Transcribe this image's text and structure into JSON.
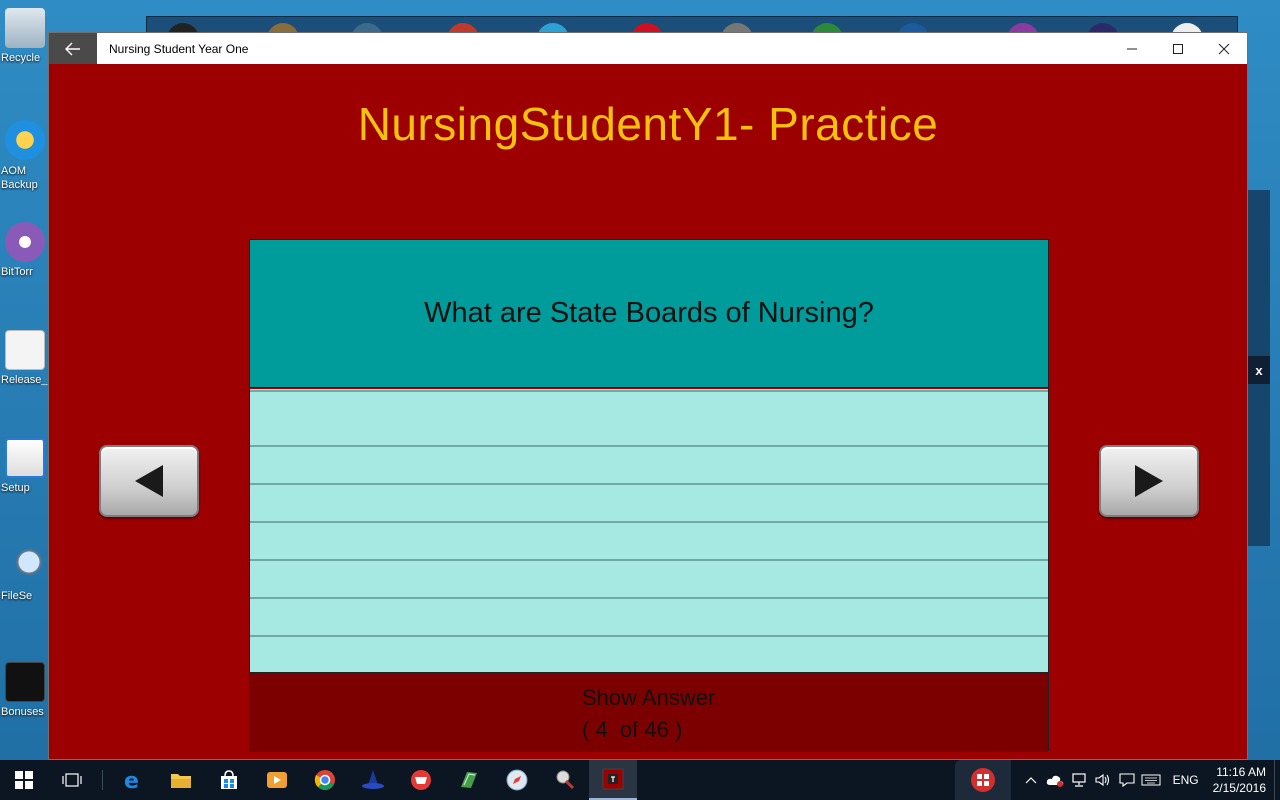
{
  "desktop": {
    "icons": [
      {
        "label": "Recycle",
        "icon": "recycle-bin-icon"
      },
      {
        "label": "AOM Backup",
        "icon": "backup-icon"
      },
      {
        "label": "BitTorr",
        "icon": "bittorrent-icon"
      },
      {
        "label": "Release_",
        "icon": "document-icon"
      },
      {
        "label": "Setup",
        "icon": "setup-icon"
      },
      {
        "label": "FileSe",
        "icon": "file-search-icon"
      },
      {
        "label": "Bonuses",
        "icon": "terminal-icon"
      }
    ]
  },
  "window": {
    "title": "Nursing Student Year One",
    "back_icon": "back-arrow-icon",
    "minimize": "—",
    "maximize": "□",
    "close": "✕"
  },
  "app": {
    "heading": "NursingStudentY1-  Practice",
    "question": "What are State Boards of Nursing?",
    "show_answer": "Show Answer",
    "counter": "( 4  of 46 )",
    "prev_icon": "triangle-left-icon",
    "next_icon": "triangle-right-icon"
  },
  "colors": {
    "app_background": "#9c0000",
    "heading": "#f4c20d",
    "question_panel": "#009b9b",
    "notepad": "#a6e9e3",
    "answer_bar": "#7c0000"
  },
  "taskbar": {
    "apps": [
      "windows-start-icon",
      "task-view-icon",
      "edge-icon",
      "file-explorer-icon",
      "store-icon",
      "media-player-icon",
      "chrome-icon",
      "wizard-icon",
      "shopping-bag-icon",
      "green-app-icon",
      "safari-icon",
      "tool-icon",
      "nursing-app-icon"
    ],
    "language": "ENG",
    "time": "11:16 AM",
    "date": "2/15/2016"
  },
  "background_window": {
    "close_label": "x"
  }
}
